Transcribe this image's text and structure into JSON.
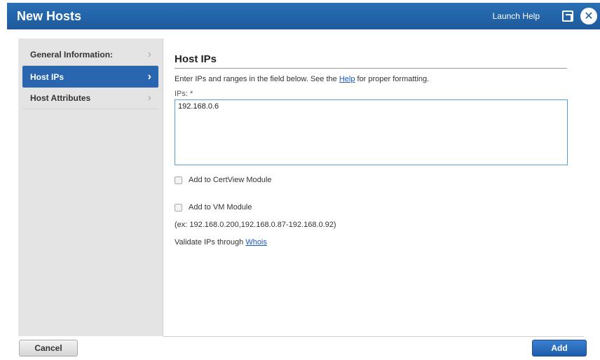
{
  "window": {
    "title": "New Hosts",
    "help_link": "Launch Help",
    "close_glyph": "✕"
  },
  "sidebar": {
    "items": [
      {
        "label": "General Information:",
        "chevron": "›"
      },
      {
        "label": "Host IPs",
        "chevron": "›"
      },
      {
        "label": "Host Attributes",
        "chevron": "›"
      }
    ],
    "active_index": 1
  },
  "main": {
    "heading": "Host IPs",
    "intro_before": "Enter IPs and ranges in the field below. See the ",
    "intro_link": "Help",
    "intro_after": " for proper formatting.",
    "ips_label": "IPs: *",
    "ips_value": "192.168.0.6",
    "certview_label": "Add to CertView Module",
    "vm_label": "Add to VM Module",
    "example": "(ex: 192.168.0.200,192.168.0.87-192.168.0.92)",
    "validate_text": "Validate IPs through ",
    "validate_link": "Whois"
  },
  "footer": {
    "cancel_label": "Cancel",
    "add_label": "Add"
  },
  "colors": {
    "titlebar": "#1e5a9c",
    "active_nav": "#2a66b0",
    "link": "#1a57c9"
  },
  "icons": [
    "popout-icon",
    "close-icon",
    "chevron-right-icon"
  ]
}
